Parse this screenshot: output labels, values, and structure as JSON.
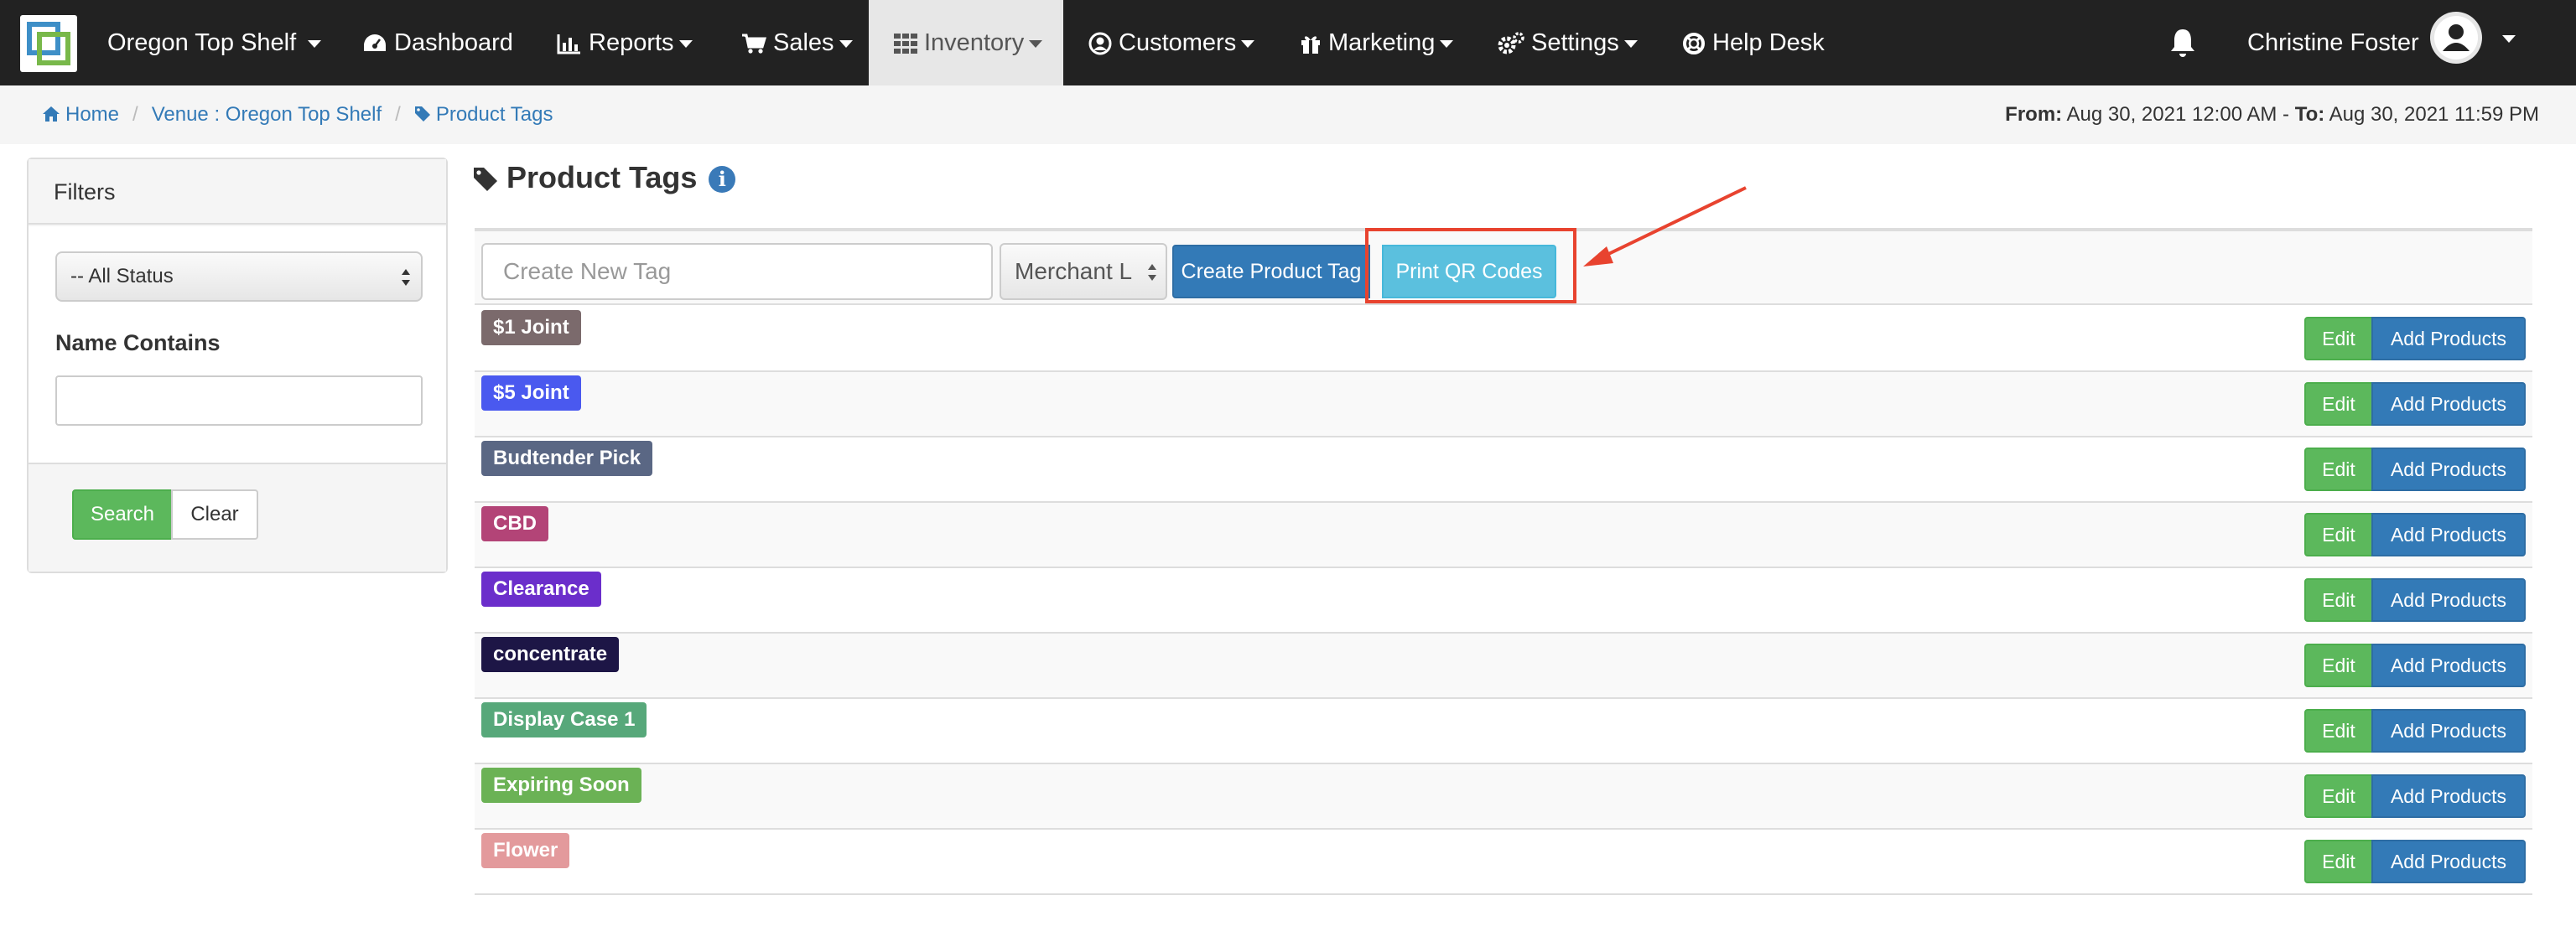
{
  "navbar": {
    "venue": "Oregon Top Shelf",
    "items": [
      {
        "label": "Dashboard",
        "icon": "dashboard-icon"
      },
      {
        "label": "Reports",
        "icon": "bar-chart-icon"
      },
      {
        "label": "Sales",
        "icon": "shopping-cart-icon"
      },
      {
        "label": "Inventory",
        "icon": "grid-icon"
      },
      {
        "label": "Customers",
        "icon": "user-circle-icon"
      },
      {
        "label": "Marketing",
        "icon": "gift-icon"
      },
      {
        "label": "Settings",
        "icon": "gears-icon"
      },
      {
        "label": "Help Desk",
        "icon": "life-ring-icon"
      }
    ],
    "active": "Inventory",
    "user_name": "Christine Foster"
  },
  "breadcrumb": {
    "home": "Home",
    "venue": "Venue : Oregon Top Shelf",
    "current": "Product Tags"
  },
  "date_range": {
    "from_label": "From:",
    "from": "Aug 30, 2021 12:00 AM",
    "separator": " - ",
    "to_label": "To:",
    "to": "Aug 30, 2021 11:59 PM"
  },
  "filters": {
    "title": "Filters",
    "status_selected": "-- All Status",
    "name_label": "Name Contains",
    "name_value": "",
    "search_label": "Search",
    "clear_label": "Clear"
  },
  "main": {
    "title": "Product Tags",
    "new_tag_placeholder": "Create New Tag",
    "merchant_selected": "Merchant L",
    "create_label": "Create Product Tag",
    "print_label": "Print QR Codes",
    "edit_label": "Edit",
    "add_label": "Add Products"
  },
  "tags": [
    {
      "name": "$1 Joint",
      "color": "#7b6a6c"
    },
    {
      "name": "$5 Joint",
      "color": "#4a59ef"
    },
    {
      "name": "Budtender Pick",
      "color": "#5a6784"
    },
    {
      "name": "CBD",
      "color": "#b34477"
    },
    {
      "name": "Clearance",
      "color": "#6b2ecb"
    },
    {
      "name": "concentrate",
      "color": "#1d1646"
    },
    {
      "name": "Display Case 1",
      "color": "#57a87a"
    },
    {
      "name": "Expiring Soon",
      "color": "#6bb255"
    },
    {
      "name": "Flower",
      "color": "#e39a9c"
    }
  ],
  "colors": {
    "navbar_bg": "#222222",
    "primary": "#337ab7",
    "success": "#5cb85c",
    "info": "#5bc0de",
    "annotation_red": "#e8432f"
  }
}
